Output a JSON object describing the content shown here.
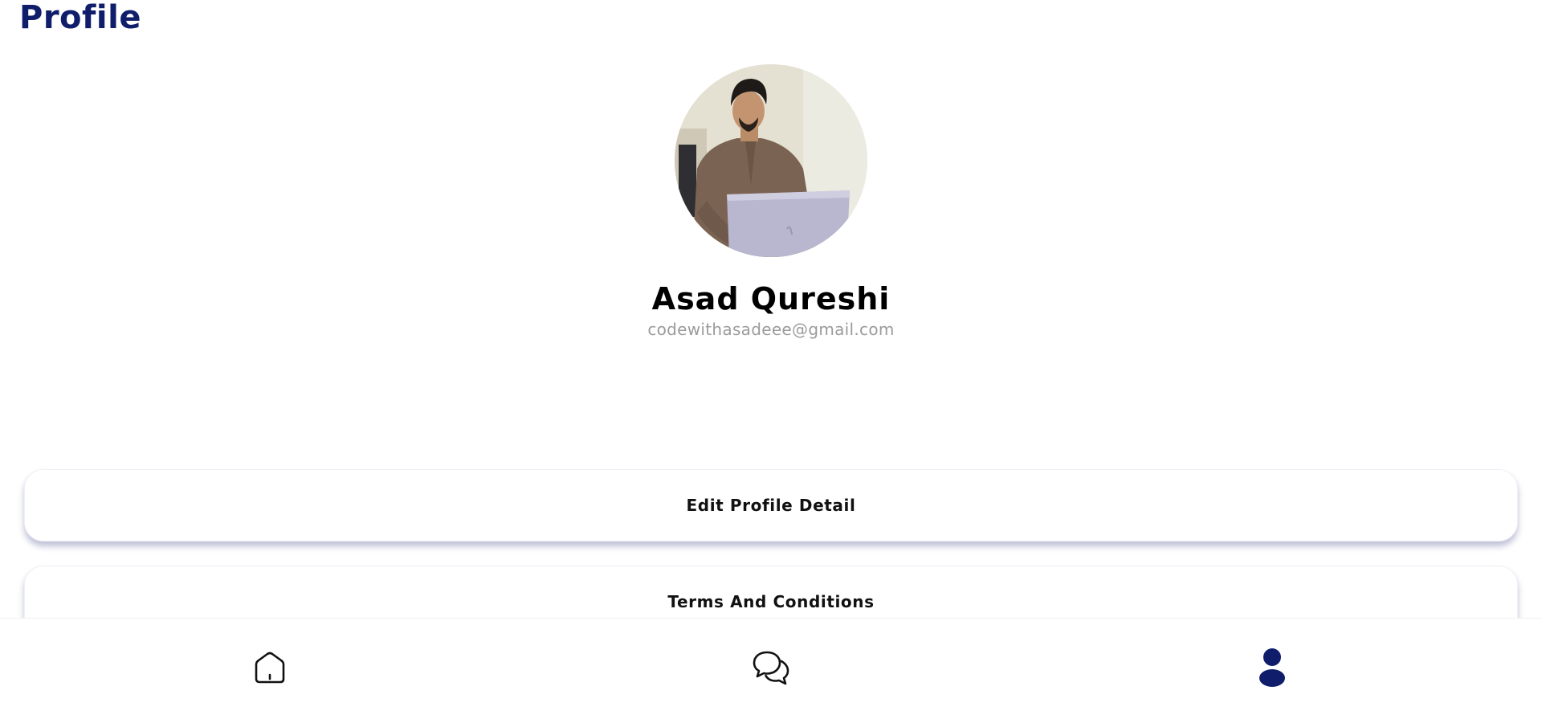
{
  "header": {
    "title": "Profile"
  },
  "profile": {
    "avatar_icon": "user-photo",
    "name": "Asad Qureshi",
    "email": "codewithasadeee@gmail.com"
  },
  "menu": {
    "items": [
      {
        "label": "Edit Profile Detail"
      },
      {
        "label": "Terms And Conditions"
      }
    ]
  },
  "bottom_nav": {
    "items": [
      {
        "icon": "home-icon",
        "active": false
      },
      {
        "icon": "chat-icon",
        "active": false
      },
      {
        "icon": "profile-icon",
        "active": true
      }
    ]
  },
  "colors": {
    "brand": "#0f1d6b",
    "email_text": "#9b9b9b",
    "card_shadow": "#1e226e"
  }
}
